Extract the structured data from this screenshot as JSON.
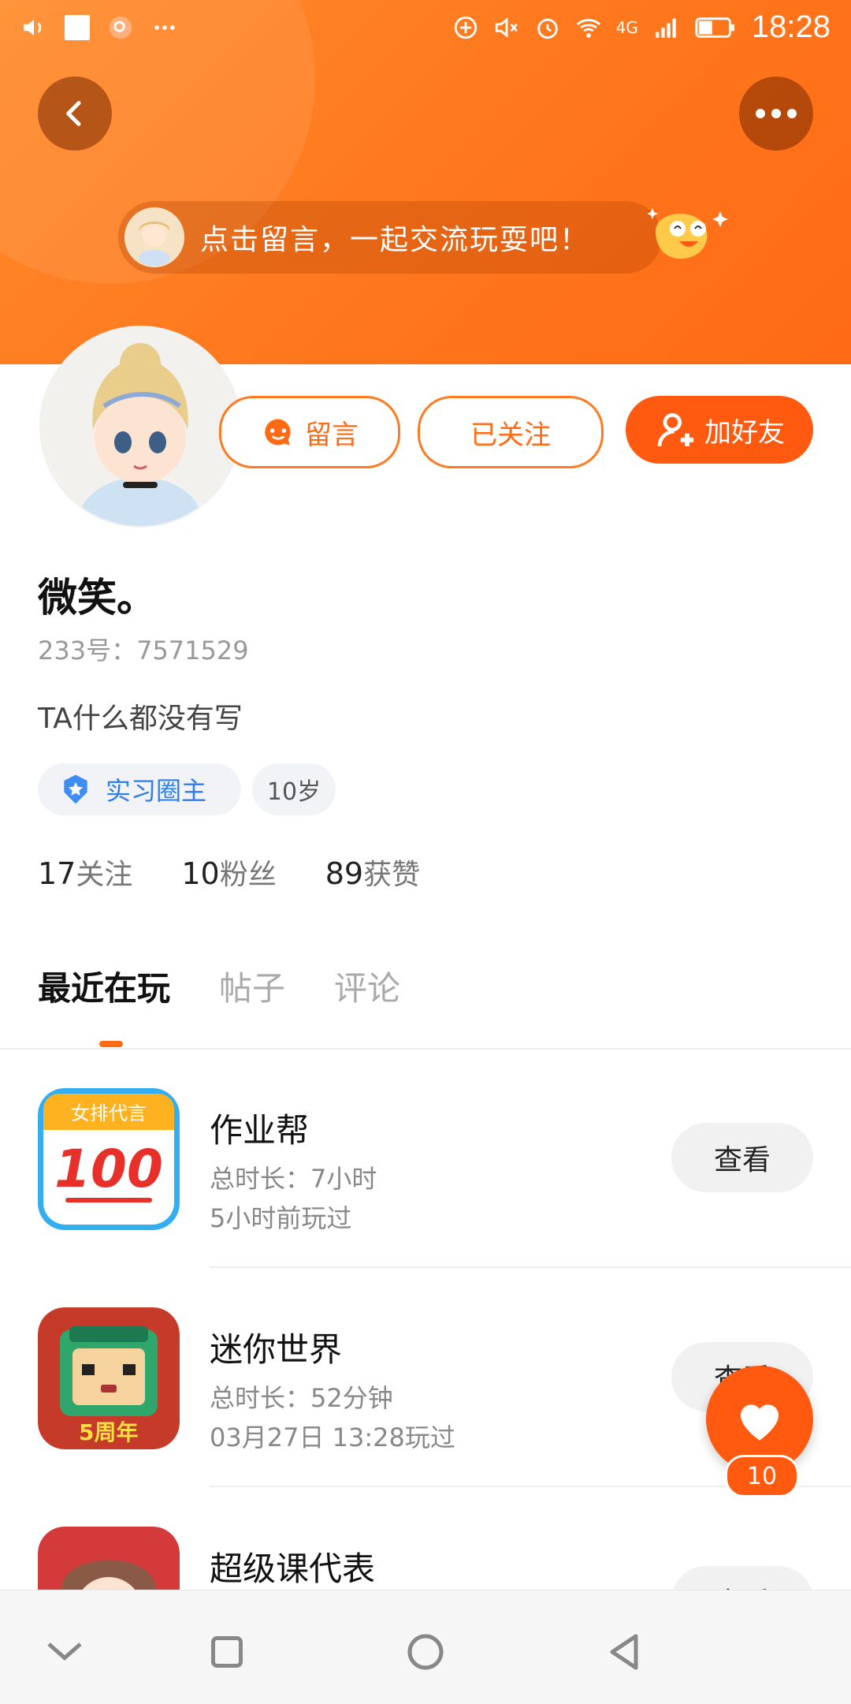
{
  "status_bar": {
    "time": "18:28",
    "network": "4G"
  },
  "banner": {
    "text": "点击留言，一起交流玩耍吧！"
  },
  "actions": {
    "message_label": "留言",
    "followed_label": "已关注",
    "add_friend_label": "加好友"
  },
  "profile": {
    "name": "微笑。",
    "uid": "233号：7571529",
    "bio": "TA什么都没有写",
    "role_tag": "实习圈主",
    "age_tag": "10岁",
    "stats": [
      {
        "value": "17",
        "label": "关注"
      },
      {
        "value": "10",
        "label": "粉丝"
      },
      {
        "value": "89",
        "label": "获赞"
      }
    ]
  },
  "tabs": [
    {
      "label": "最近在玩"
    },
    {
      "label": "帖子"
    },
    {
      "label": "评论"
    }
  ],
  "games": [
    {
      "title": "作业帮",
      "total_time": "总时长：7小时",
      "last_played": "5小时前玩过",
      "view_label": "查看",
      "icon_text_top": "女排代言",
      "icon_text_main": "100"
    },
    {
      "title": "迷你世界",
      "total_time": "总时长：52分钟",
      "last_played": "03月27日 13:28玩过",
      "view_label": "查看",
      "icon_text_badge": "5周年"
    },
    {
      "title": "超级课代表",
      "view_label": "查看"
    }
  ],
  "like": {
    "count": "10"
  },
  "colors": {
    "accent": "#ff6a14",
    "blue": "#2f7ee9"
  }
}
